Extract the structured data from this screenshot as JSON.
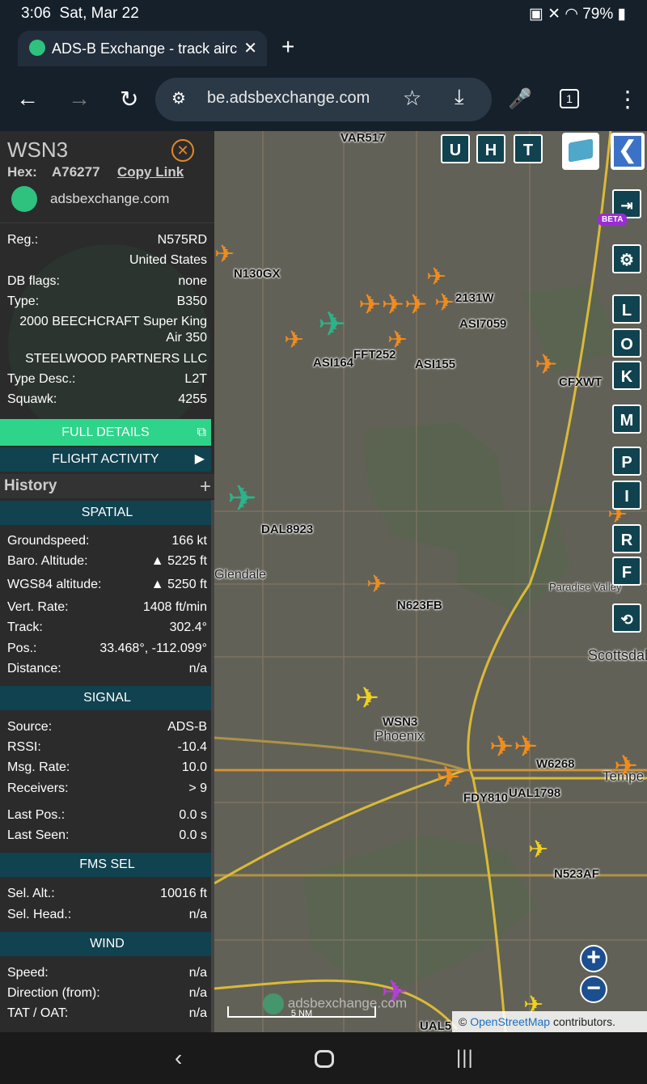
{
  "status_bar": {
    "time": "3:06",
    "date": "Sat, Mar 22",
    "battery": "79%"
  },
  "browser": {
    "tab_title": "ADS-B Exchange - track aircra",
    "url": "be.adsbexchange.com",
    "tab_count": "1"
  },
  "panel": {
    "callsign": "WSN3",
    "hex_label": "Hex:",
    "hex": "A76277",
    "copy_link": "Copy Link",
    "site": "adsbexchange.com",
    "info": [
      {
        "k": "Reg.:",
        "v": "N575RD"
      },
      {
        "k": "",
        "v": "United States"
      },
      {
        "k": "DB flags:",
        "v": "none"
      },
      {
        "k": "Type:",
        "v": "B350"
      },
      {
        "k": "",
        "v": "2000 BEECHCRAFT Super King"
      },
      {
        "k": "",
        "v": "Air 350"
      },
      {
        "k": "",
        "v": "STEELWOOD PARTNERS LLC"
      },
      {
        "k": "Type Desc.:",
        "v": "L2T"
      },
      {
        "k": "Squawk:",
        "v": "4255"
      }
    ],
    "full_details": "FULL DETAILS",
    "flight_activity": "FLIGHT ACTIVITY",
    "history": "History",
    "spatial_title": "SPATIAL",
    "spatial": [
      {
        "k": "Groundspeed:",
        "v": "166 kt"
      },
      {
        "k": "Baro. Altitude:",
        "v": "▲ 5225 ft"
      },
      {
        "k": "WGS84 altitude:",
        "v": "▲ 5250 ft"
      },
      {
        "k": "Vert. Rate:",
        "v": "1408 ft/min"
      },
      {
        "k": "Track:",
        "v": "302.4°"
      },
      {
        "k": "Pos.:",
        "v": "33.468°, -112.099°"
      },
      {
        "k": "Distance:",
        "v": "n/a"
      }
    ],
    "signal_title": "SIGNAL",
    "signal": [
      {
        "k": "Source:",
        "v": "ADS-B"
      },
      {
        "k": "RSSI:",
        "v": "-10.4"
      },
      {
        "k": "Msg. Rate:",
        "v": "10.0"
      },
      {
        "k": "Receivers:",
        "v": "> 9"
      },
      {
        "k": "Last Pos.:",
        "v": "0.0 s"
      },
      {
        "k": "Last Seen:",
        "v": "0.0 s"
      }
    ],
    "fms_title": "FMS SEL",
    "fms": [
      {
        "k": "Sel. Alt.:",
        "v": "10016 ft"
      },
      {
        "k": "Sel. Head.:",
        "v": "n/a"
      }
    ],
    "wind_title": "WIND",
    "wind": [
      {
        "k": "Speed:",
        "v": "n/a"
      },
      {
        "k": "Direction (from):",
        "v": "n/a"
      },
      {
        "k": "TAT / OAT:",
        "v": "n/a"
      }
    ]
  },
  "map": {
    "top_buttons": [
      "U",
      "H",
      "T"
    ],
    "side_buttons": [
      "L",
      "O",
      "K",
      "M",
      "P",
      "I",
      "R",
      "F"
    ],
    "beta": "BETA",
    "scale": "5 NM",
    "watermark": "adsbexchange.com",
    "attribution_prefix": "©",
    "attribution_link": "OpenStreetMap",
    "attribution_suffix": "contributors.",
    "places": [
      "Glendale",
      "Phoenix",
      "Scottsdal",
      "Tempe",
      "Paradise Valley"
    ],
    "aircraft": [
      "VAR517",
      "N130GX",
      "ASI164",
      "FFT252",
      "ASI155",
      "ASI7059",
      "2131W",
      "CFXWT",
      "DAL8923",
      "N623FB",
      "WSN3",
      "FDY810",
      "UAL1798",
      "W6268",
      "N523AF",
      "UAL5"
    ]
  }
}
